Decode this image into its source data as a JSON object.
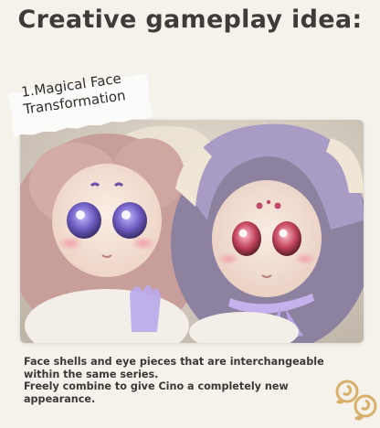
{
  "heading": "Creative gameplay idea:",
  "label": {
    "line1": "1.Magical Face",
    "line2": "Transformation"
  },
  "caption": {
    "line1": "Face shells and eye pieces that are interchangeable",
    "line2": "within the same series.",
    "line3": "Freely combine to give Cino a completely new",
    "line4": "appearance."
  },
  "colors": {
    "background": "#f5f2ec",
    "heading_text": "#3f3b38",
    "doll_left_fur": "#c79e9a",
    "doll_right_fur": "#8c82a0",
    "bonnet_lavender": "#a89bc4",
    "rose_gold": "#d9b06a"
  }
}
